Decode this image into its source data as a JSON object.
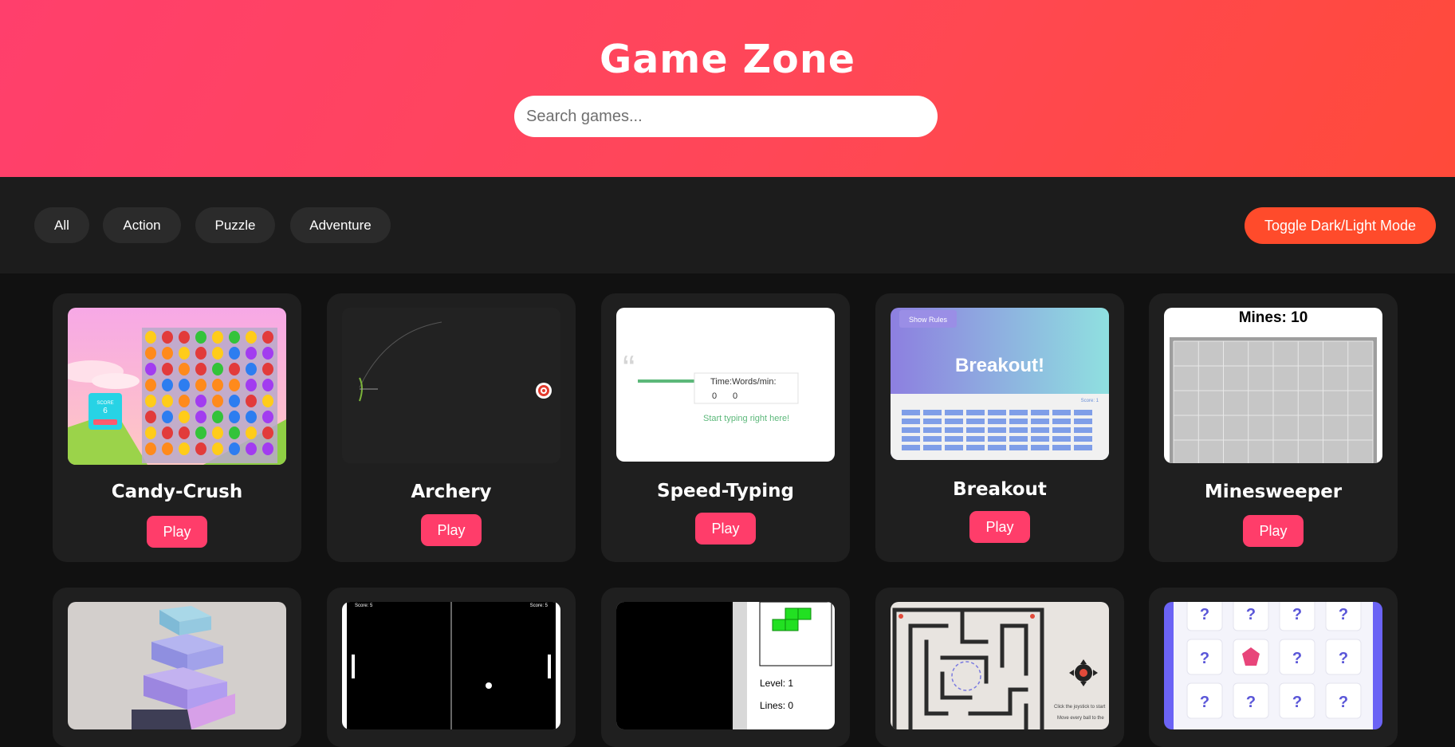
{
  "header": {
    "title": "Game Zone",
    "search_placeholder": "Search games..."
  },
  "filters": {
    "items": [
      "All",
      "Action",
      "Puzzle",
      "Adventure"
    ],
    "toggle_label": "Toggle Dark/Light Mode"
  },
  "games": [
    {
      "title": "Candy-Crush",
      "play": "Play",
      "thumb": {
        "score_label": "SCORE",
        "score_value": "6"
      }
    },
    {
      "title": "Archery",
      "play": "Play"
    },
    {
      "title": "Speed-Typing",
      "play": "Play",
      "thumb": {
        "stats_label": "Time:Words/min:",
        "time": "0",
        "wpm": "0",
        "prompt": "Start typing right here!"
      }
    },
    {
      "title": "Breakout",
      "play": "Play",
      "thumb": {
        "rules_button": "Show Rules",
        "heading": "Breakout!",
        "score": "Score: 1"
      }
    },
    {
      "title": "Minesweeper",
      "play": "Play",
      "thumb": {
        "mines": "Mines: 10"
      }
    },
    {
      "title": "",
      "play": ""
    },
    {
      "title": "",
      "play": "",
      "thumb": {
        "score_left": "Score: 5",
        "score_right": "Score: 5"
      }
    },
    {
      "title": "",
      "play": "",
      "thumb": {
        "level": "Level: 1",
        "lines": "Lines: 0"
      }
    },
    {
      "title": "",
      "play": "",
      "thumb": {
        "instruction_1": "Click the joystick to start",
        "instruction_2": "Move every ball to the"
      }
    },
    {
      "title": "",
      "play": "",
      "thumb": {
        "hidden_mark": "?"
      }
    }
  ],
  "colors": {
    "header_gradient_start": "#ff3f6c",
    "header_gradient_end": "#ff4a3a",
    "play_button": "#ff3d6a",
    "toggle_button": "#ff4b2b",
    "card_background": "#1f1f1f"
  }
}
